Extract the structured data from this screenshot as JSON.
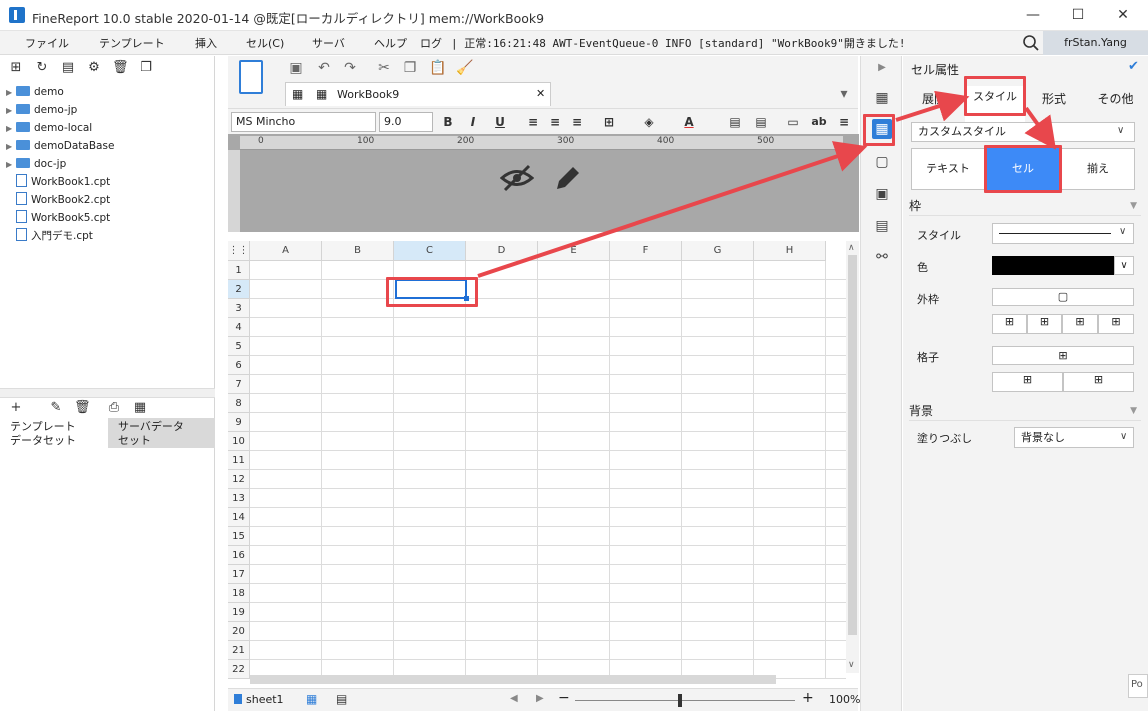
{
  "window": {
    "title": "FineReport 10.0 stable 2020-01-14 @既定[ローカルディレクトリ]    mem://WorkBook9",
    "minimize": "—",
    "maximize": "☐",
    "close": "✕"
  },
  "menubar": {
    "items": [
      "ファイル",
      "テンプレート",
      "挿入",
      "セル(C)",
      "サーバ",
      "ヘルプ",
      "ログ"
    ],
    "log": "| 正常:16:21:48 AWT-EventQueue-0 INFO [standard] \"WorkBook9\"開きました!",
    "user": "frStan.Yang"
  },
  "explorer": {
    "items": [
      {
        "label": "demo",
        "type": "folder"
      },
      {
        "label": "demo-jp",
        "type": "folder"
      },
      {
        "label": "demo-local",
        "type": "folder"
      },
      {
        "label": "demoDataBase",
        "type": "folder"
      },
      {
        "label": "doc-jp",
        "type": "folder"
      },
      {
        "label": "WorkBook1.cpt",
        "type": "file"
      },
      {
        "label": "WorkBook2.cpt",
        "type": "file"
      },
      {
        "label": "WorkBook5.cpt",
        "type": "file"
      },
      {
        "label": "入門デモ.cpt",
        "type": "file"
      }
    ],
    "dataset_tabs": [
      "テンプレート\nデータセット",
      "サーバデータ\nセット"
    ]
  },
  "editor": {
    "doc_tab": "WorkBook9",
    "font_name": "MS Mincho",
    "font_size": "9.0",
    "ruler_ticks": [
      "0",
      "100",
      "200",
      "300",
      "400",
      "500"
    ],
    "columns": [
      "A",
      "B",
      "C",
      "D",
      "E",
      "F",
      "G",
      "H"
    ],
    "rows": [
      "1",
      "2",
      "3",
      "4",
      "5",
      "6",
      "7",
      "8",
      "9",
      "10",
      "11",
      "12",
      "13",
      "14",
      "15",
      "16",
      "17",
      "18",
      "19",
      "20",
      "21",
      "22"
    ],
    "sheet_tab": "sheet1",
    "zoom": "100%",
    "zoom_minus": "−",
    "zoom_plus": "+"
  },
  "cell_props": {
    "title": "セル属性",
    "tabs": [
      "展開",
      "スタイル",
      "形式",
      "その他"
    ],
    "style_select": "カスタムスタイル",
    "subtabs": [
      "テキスト",
      "セル",
      "揃え"
    ],
    "section_border": "枠",
    "label_style": "スタイル",
    "label_color": "色",
    "label_outer": "外枠",
    "label_inner": "格子",
    "section_bg": "背景",
    "label_fill": "塗りつぶし",
    "fill_value": "背景なし",
    "corner_tag": "Po"
  },
  "colors": {
    "accent": "#3d8af7",
    "highlight": "#e8474c",
    "selected_cell": "#1f6fd6"
  }
}
